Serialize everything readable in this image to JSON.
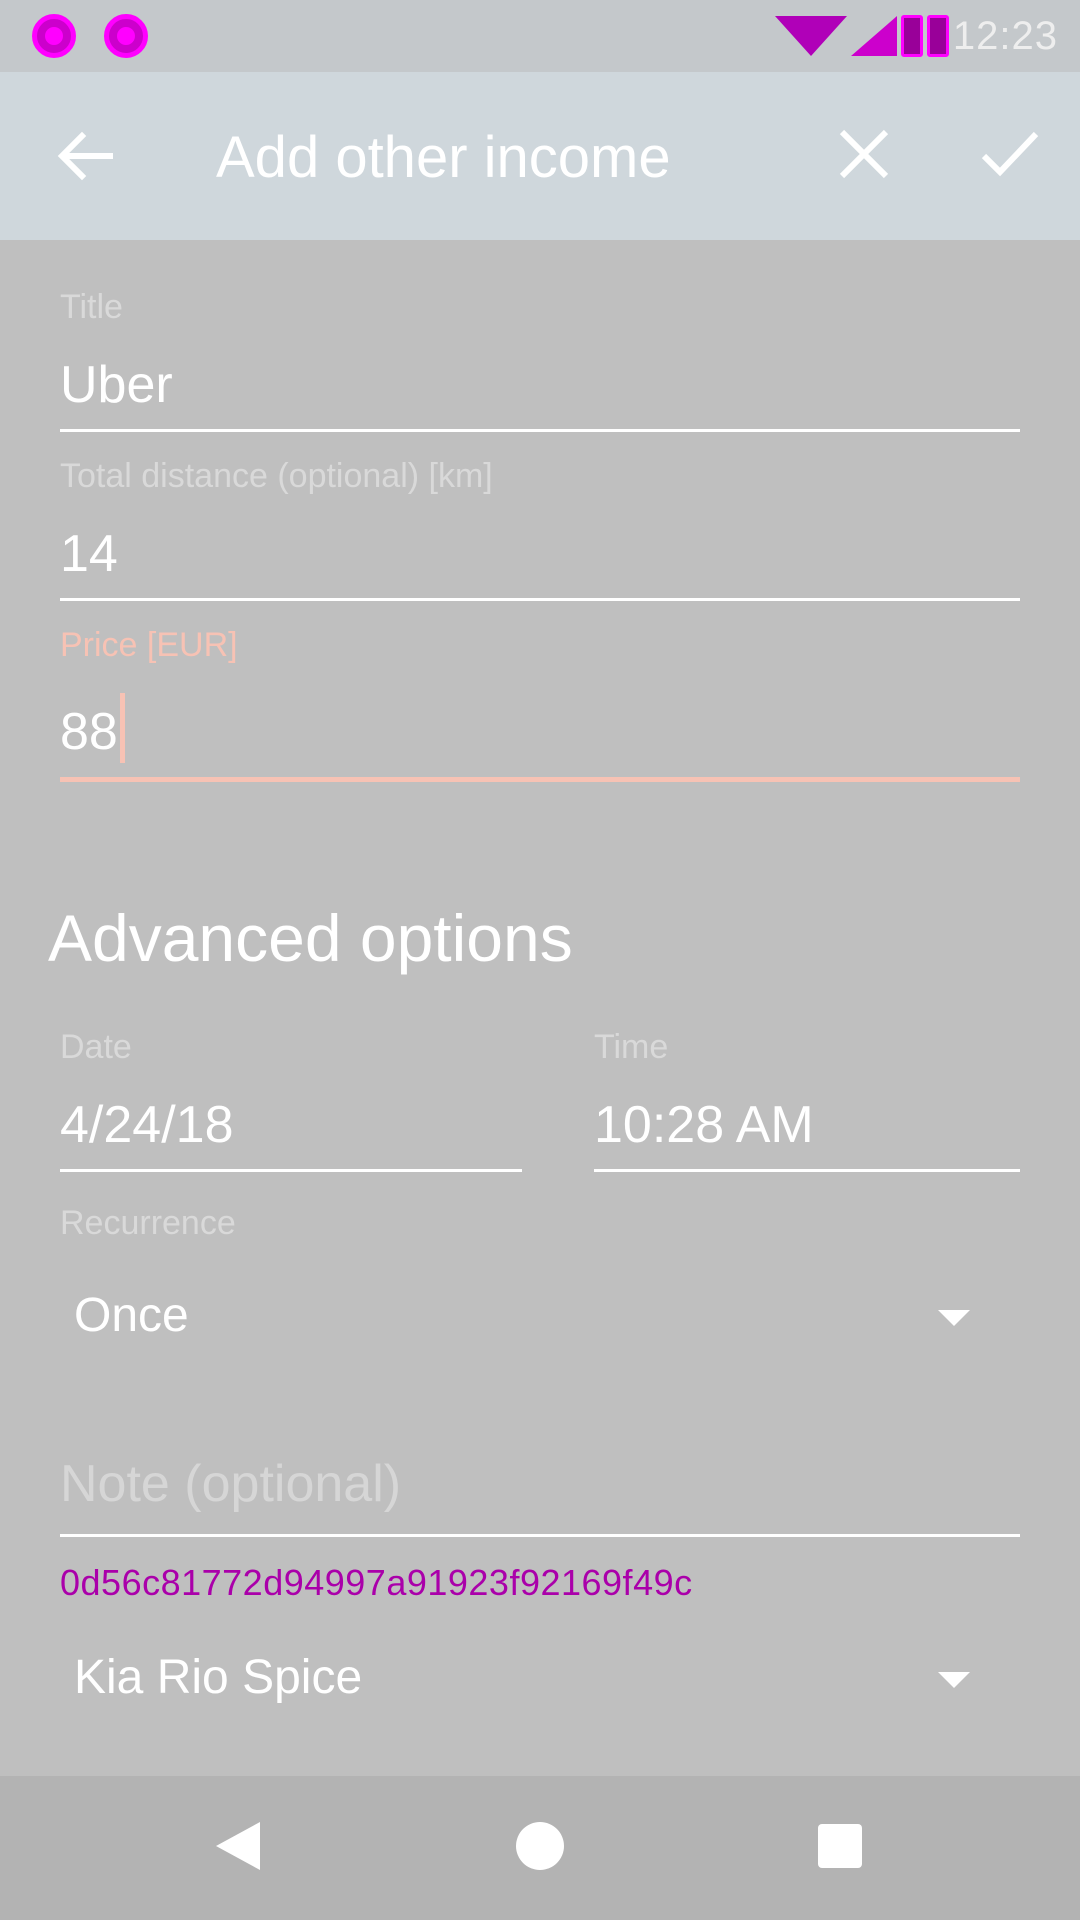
{
  "status_bar": {
    "time": "12:23",
    "icons": [
      "notification-icon",
      "notification-icon",
      "wifi-icon",
      "signal-icon",
      "battery-icon"
    ]
  },
  "app_bar": {
    "title": "Add other income",
    "back_icon": "arrow-left-icon",
    "close_icon": "close-icon",
    "confirm_icon": "check-icon"
  },
  "form": {
    "title": {
      "label": "Title",
      "value": "Uber"
    },
    "distance": {
      "label": "Total distance (optional) [km]",
      "value": "14"
    },
    "price": {
      "label": "Price [EUR]",
      "value": "88",
      "focused": true
    }
  },
  "advanced": {
    "heading": "Advanced options",
    "date": {
      "label": "Date",
      "value": "4/24/18"
    },
    "time": {
      "label": "Time",
      "value": "10:28 AM"
    },
    "recurrence": {
      "label": "Recurrence",
      "selected": "Once"
    },
    "note": {
      "placeholder": "Note (optional)",
      "value": ""
    },
    "hash_text": "0d56c81772d94997a91923f92169f49c",
    "vehicle": {
      "selected": "Kia Rio Spice"
    }
  },
  "nav_bar": {
    "icons": [
      "back-triangle-icon",
      "home-circle-icon",
      "recent-square-icon"
    ]
  },
  "colors": {
    "accent": "#f7c2b4",
    "app_bar": "#cfd7dc",
    "background": "#bfbfbf"
  }
}
